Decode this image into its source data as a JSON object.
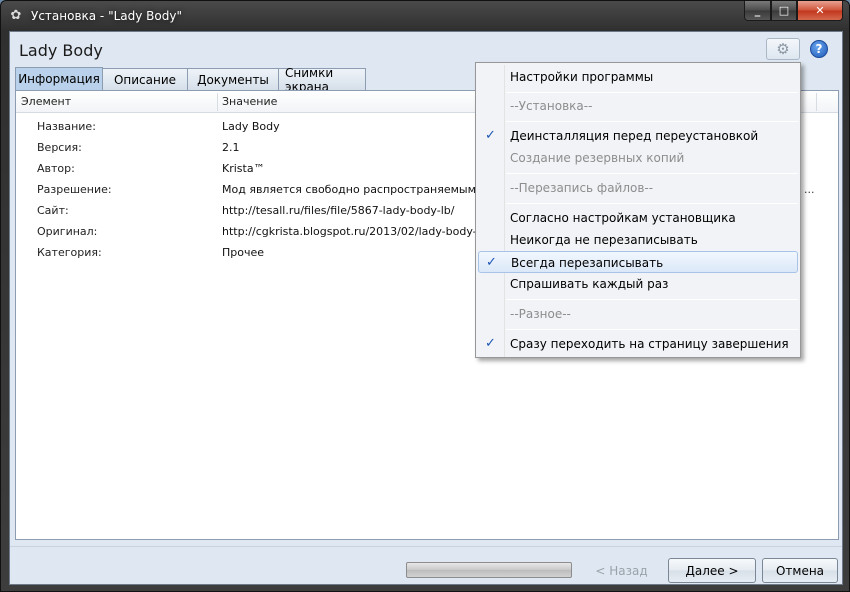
{
  "window": {
    "title": "Установка - \"Lady Body\"",
    "icon": "gear-installer-icon",
    "min": "_",
    "max": "□",
    "close": "✕"
  },
  "header": {
    "title": "Lady Body",
    "gear_icon": "⚙",
    "help_icon": "?"
  },
  "tabs": [
    {
      "label": "Информация",
      "active": true
    },
    {
      "label": "Описание",
      "active": false
    },
    {
      "label": "Документы",
      "active": false
    },
    {
      "label": "Снимки экрана",
      "active": false
    }
  ],
  "table": {
    "col_element": "Элемент",
    "col_value": "Значение",
    "rows": [
      {
        "key": "Название:",
        "value": "Lady Body"
      },
      {
        "key": "Версия:",
        "value": "2.1"
      },
      {
        "key": "Автор:",
        "value": "Krista™"
      },
      {
        "key": "Разрешение:",
        "value": "Мод является свободно распространяемым, поэт",
        "more": "..."
      },
      {
        "key": "Сайт:",
        "value": "http://tesall.ru/files/file/5867-lady-body-lb/"
      },
      {
        "key": "Оригинал:",
        "value": "http://cgkrista.blogspot.ru/2013/02/lady-body-lb-v21"
      },
      {
        "key": "Категория:",
        "value": "Прочее"
      }
    ]
  },
  "footer": {
    "back_label": "< Назад",
    "next_label": "Далее >",
    "cancel_label": "Отмена"
  },
  "menu": {
    "items": [
      {
        "label": "Настройки программы"
      },
      {
        "label": "--Установка--",
        "disabled": true
      },
      {
        "label": "Деинсталляция перед переустановкой",
        "checked": true
      },
      {
        "label": "Создание резервных копий",
        "disabled": true
      },
      {
        "label": "--Перезапись файлов--",
        "disabled": true
      },
      {
        "label": "Согласно настройкам установщика"
      },
      {
        "label": "Неикогда не перезаписывать"
      },
      {
        "label": "Всегда перезаписывать",
        "checked": true,
        "highlighted": true
      },
      {
        "label": "Спрашивать каждый раз"
      },
      {
        "label": "--Разное--",
        "disabled": true
      },
      {
        "label": "Сразу переходить на страницу завершения",
        "checked": true
      }
    ],
    "check_glyph": "✓"
  }
}
